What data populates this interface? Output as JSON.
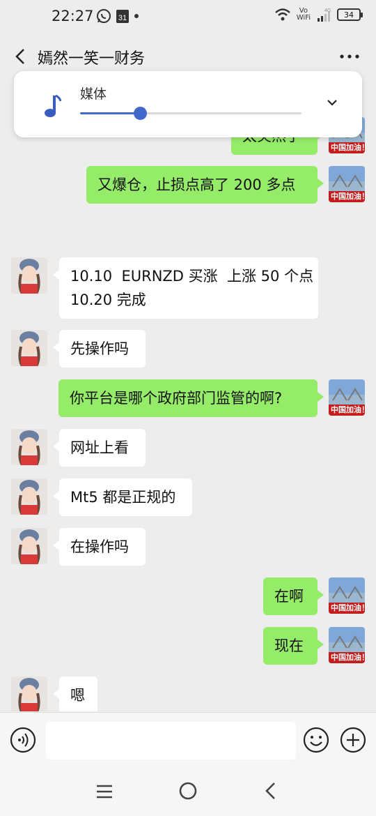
{
  "status_bar": {
    "time": "22:27",
    "calendar_day": "31",
    "vowifi_top": "Vo",
    "vowifi_bottom": "WiFi",
    "network": "4G",
    "battery": "34"
  },
  "header": {
    "title": "嫣然一笑一财务"
  },
  "media_panel": {
    "label": "媒体",
    "volume_level": 0.27,
    "accent_color": "#4169c9"
  },
  "avatar_labels": {
    "self": "中国加油！"
  },
  "messages": [
    {
      "side": "out",
      "text": "太突然了"
    },
    {
      "side": "out",
      "text": "又爆仓，止损点高了 200 多点"
    },
    {
      "side": "in",
      "text": "10.10  EURNZD 买涨  上涨 50 个点\n10.20 完成"
    },
    {
      "side": "in",
      "text": "先操作吗"
    },
    {
      "side": "out",
      "text": "你平台是哪个政府部门监管的啊?"
    },
    {
      "side": "in",
      "text": "网址上看"
    },
    {
      "side": "in",
      "text": "Mt5 都是正规的"
    },
    {
      "side": "in",
      "text": "在操作吗"
    },
    {
      "side": "out",
      "text": "在啊"
    },
    {
      "side": "out",
      "text": "现在"
    },
    {
      "side": "in",
      "text": "嗯"
    }
  ],
  "colors": {
    "background": "#ededed",
    "outgoing_bubble": "#95ec69",
    "incoming_bubble": "#ffffff"
  },
  "icons": {
    "status_left": [
      "whatsapp-icon",
      "calendar-icon",
      "dot-icon"
    ],
    "status_right": [
      "wifi-icon",
      "vowifi-icon",
      "signal-icon",
      "battery-icon"
    ],
    "header": [
      "back-icon",
      "more-icon"
    ],
    "input_bar": [
      "voice-icon",
      "emoji-icon",
      "plus-icon"
    ],
    "nav_bar": [
      "menu-icon",
      "home-icon",
      "back-nav-icon"
    ]
  }
}
